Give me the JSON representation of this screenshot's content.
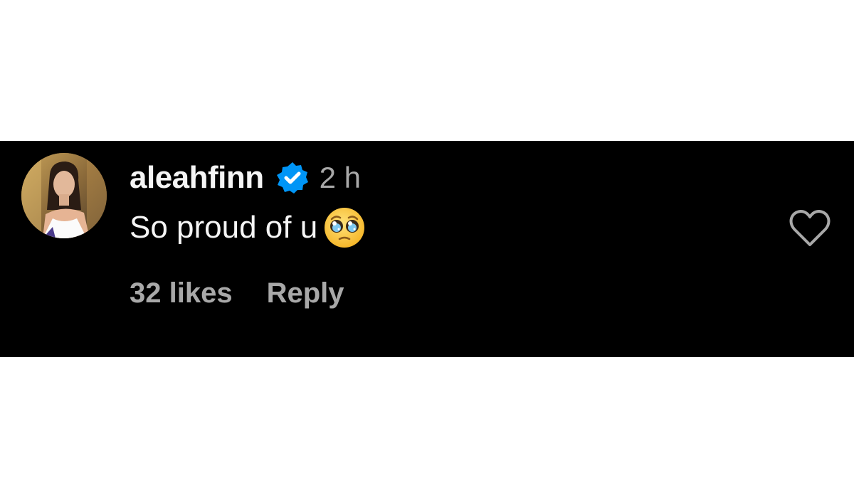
{
  "comment": {
    "username": "aleahfinn",
    "verified": true,
    "timestamp": "2 h",
    "text": "So proud of u",
    "emoji": "pleading-face-emoji",
    "likes_label": "32 likes",
    "reply_label": "Reply"
  },
  "colors": {
    "background": "#000000",
    "primary_text": "#f5f5f5",
    "secondary_text": "#a8a8a8",
    "verified_badge": "#0095f6",
    "heart_outline": "#a8a8a8"
  },
  "icons": {
    "avatar": "profile-photo",
    "verified": "verified-badge-icon",
    "like": "heart-outline-icon"
  }
}
